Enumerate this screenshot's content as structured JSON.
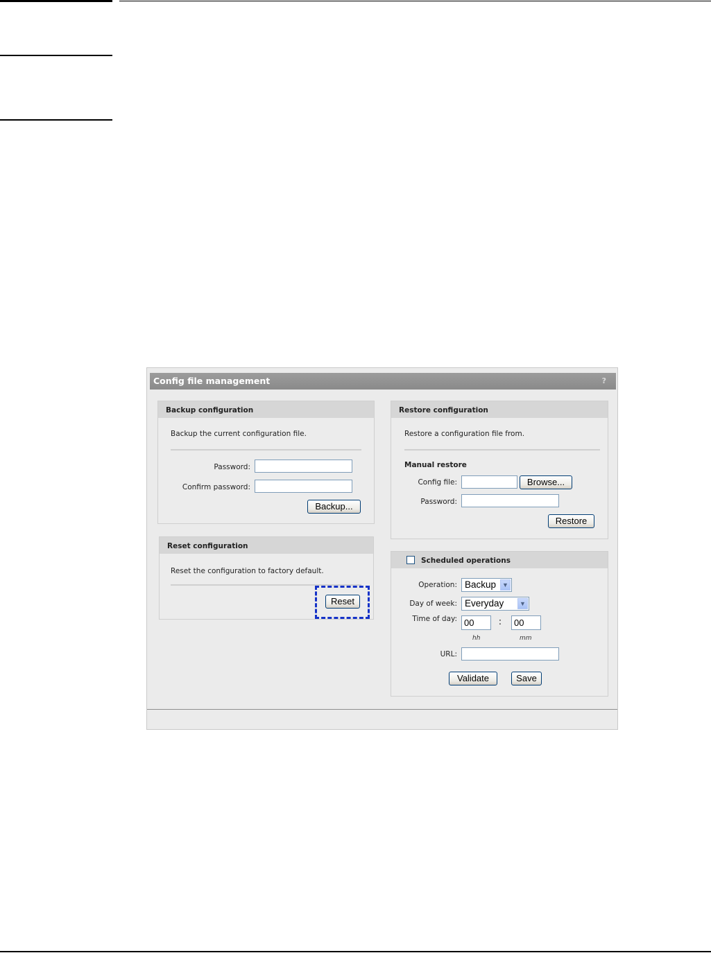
{
  "window": {
    "title": "Config file management",
    "help": "?"
  },
  "backup": {
    "heading": "Backup configuration",
    "description": "Backup the current configuration file.",
    "password_label": "Password:",
    "password_value": "",
    "confirm_label": "Confirm password:",
    "confirm_value": "",
    "button": "Backup..."
  },
  "reset": {
    "heading": "Reset configuration",
    "description": "Reset the configuration to factory default.",
    "button": "Reset"
  },
  "restore": {
    "heading": "Restore configuration",
    "description": "Restore a configuration file from.",
    "manual_heading": "Manual restore",
    "config_file_label": "Config file:",
    "config_file_value": "",
    "browse_button": "Browse...",
    "password_label": "Password:",
    "password_value": "",
    "button": "Restore"
  },
  "scheduled": {
    "heading": "Scheduled operations",
    "checked": false,
    "operation_label": "Operation:",
    "operation_value": "Backup",
    "day_label": "Day of week:",
    "day_value": "Everyday",
    "time_label": "Time of day:",
    "hour_value": "00",
    "minute_value": "00",
    "separator": ":",
    "hour_unit": "hh",
    "minute_unit": "mm",
    "url_label": "URL:",
    "url_value": "",
    "validate_button": "Validate",
    "save_button": "Save"
  }
}
